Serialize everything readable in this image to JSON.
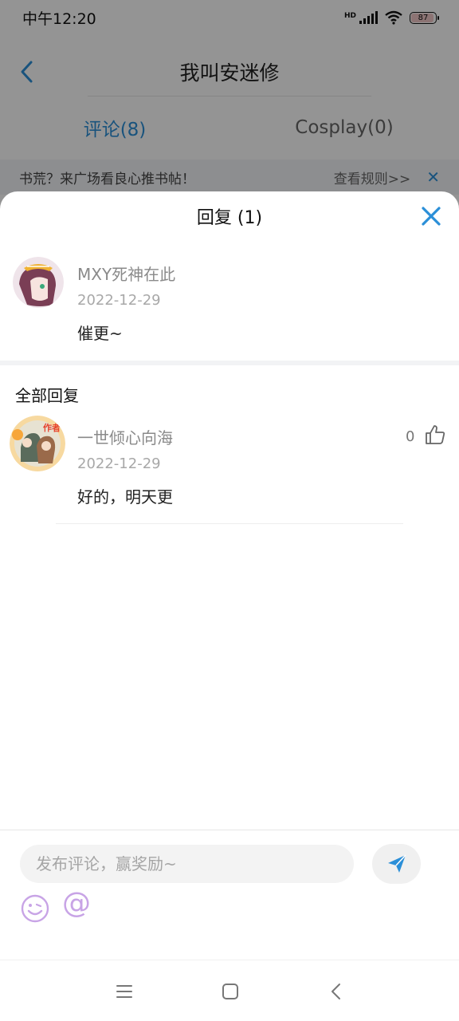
{
  "status_bar": {
    "time": "中午12:20",
    "network_label": "HD",
    "battery": "87"
  },
  "page": {
    "title": "我叫安迷修",
    "tabs": [
      {
        "label": "评论(8)",
        "active": true
      },
      {
        "label": "Cosplay(0)",
        "active": false
      }
    ],
    "notice": {
      "text": "书荒？来广场看良心推书帖！",
      "link": "查看规则>>"
    }
  },
  "sheet": {
    "title": "回复 (1)",
    "main_comment": {
      "user": "MXY死神在此",
      "date": "2022-12-29",
      "text": "催更~"
    },
    "section_title": "全部回复",
    "replies": [
      {
        "user": "一世倾心向海",
        "date": "2022-12-29",
        "text": "好的，明天更",
        "likes": "0",
        "badge": "作者"
      }
    ],
    "composer": {
      "placeholder": "发布评论，赢奖励~"
    }
  },
  "colors": {
    "accent": "#2b8fd8",
    "icon_purple": "#c8a4e6"
  },
  "icons": [
    "back-icon",
    "close-icon",
    "like-icon",
    "send-icon",
    "emoji-icon",
    "at-icon",
    "menu-icon",
    "home-icon",
    "back-nav-icon"
  ]
}
